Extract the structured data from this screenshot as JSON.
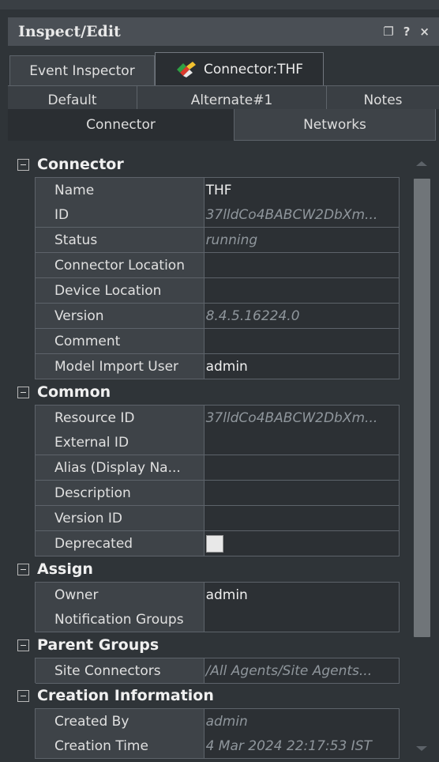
{
  "window": {
    "title": "Inspect/Edit",
    "restore_glyph": "❐",
    "help_glyph": "?",
    "close_glyph": "×"
  },
  "main_tabs": [
    {
      "label": "Event Inspector",
      "active": false
    },
    {
      "label": "Connector:THF",
      "active": true,
      "icon": "connector-icon"
    }
  ],
  "sub_tabs_row1": [
    "Default",
    "Alternate#1",
    "Notes"
  ],
  "sub_tabs_row2": [
    "Connector",
    "Networks"
  ],
  "sections": [
    {
      "title": "Connector",
      "rows": [
        {
          "key": "Name",
          "value": "THF",
          "readonly": false
        },
        {
          "key": "ID",
          "value": "37lldCo4BABCW2DbXm...",
          "readonly": true
        },
        {
          "key": "Status",
          "value": "running",
          "readonly": true
        },
        {
          "key": "Connector Location",
          "value": "",
          "readonly": false
        },
        {
          "key": "Device Location",
          "value": "",
          "readonly": false
        },
        {
          "key": "Version",
          "value": "8.4.5.16224.0",
          "readonly": true
        },
        {
          "key": "Comment",
          "value": "",
          "readonly": false
        },
        {
          "key": "Model Import User",
          "value": "admin",
          "readonly": false
        }
      ]
    },
    {
      "title": "Common",
      "rows": [
        {
          "key": "Resource ID",
          "value": "37lldCo4BABCW2DbXm...",
          "readonly": true
        },
        {
          "key": "External ID",
          "value": "",
          "readonly": false
        },
        {
          "key": "Alias (Display Na...",
          "value": "",
          "readonly": false
        },
        {
          "key": "Description",
          "value": "",
          "readonly": false
        },
        {
          "key": "Version ID",
          "value": "",
          "readonly": false
        },
        {
          "key": "Deprecated",
          "value": "",
          "readonly": false,
          "checkbox": true,
          "checked": false
        }
      ]
    },
    {
      "title": "Assign",
      "rows": [
        {
          "key": "Owner",
          "value": "admin",
          "readonly": false
        },
        {
          "key": "Notification Groups",
          "value": "",
          "readonly": false
        }
      ]
    },
    {
      "title": "Parent Groups",
      "rows": [
        {
          "key": "Site Connectors",
          "value": "/All Agents/Site Agents...",
          "readonly": true
        }
      ]
    },
    {
      "title": "Creation Information",
      "rows": [
        {
          "key": "Created By",
          "value": "admin",
          "readonly": true
        },
        {
          "key": "Creation Time",
          "value": "4 Mar 2024 22:17:53 IST",
          "readonly": true
        }
      ]
    }
  ],
  "colors": {
    "panel": "#2f3438",
    "cell_key": "#3e4348",
    "cell_value": "#2c3034",
    "grid": "#5d636a",
    "readonly_text": "#8f969c"
  }
}
